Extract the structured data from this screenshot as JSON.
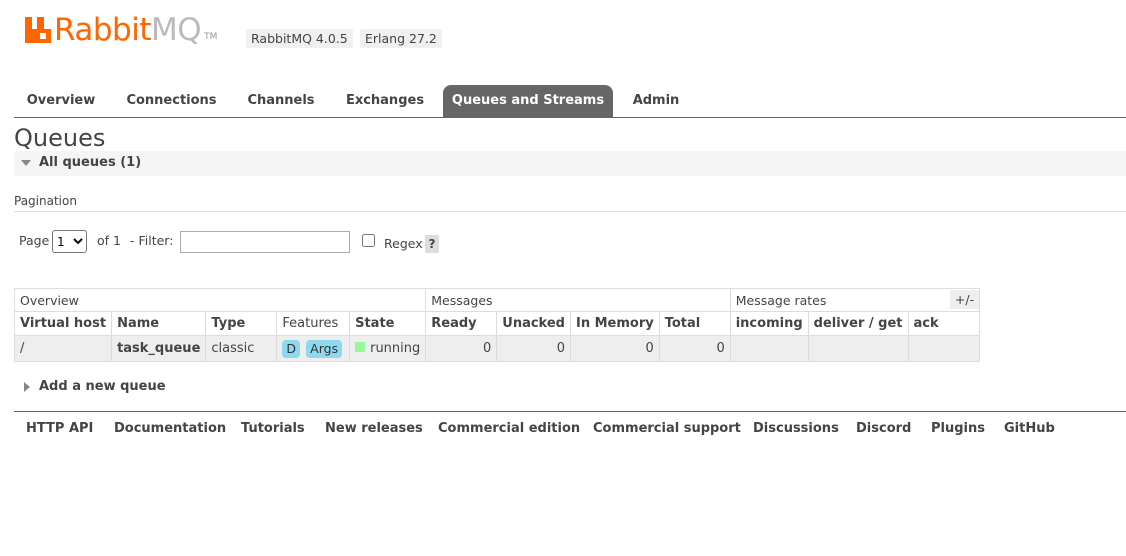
{
  "header": {
    "logo_rabbit": "Rabbit",
    "logo_mq": "MQ",
    "logo_tm": "TM",
    "rabbitmq_version": "RabbitMQ 4.0.5",
    "erlang_version": "Erlang 27.2"
  },
  "tabs": [
    {
      "label": "Overview"
    },
    {
      "label": "Connections"
    },
    {
      "label": "Channels"
    },
    {
      "label": "Exchanges"
    },
    {
      "label": "Queues and Streams",
      "active": true
    },
    {
      "label": "Admin"
    }
  ],
  "page": {
    "title": "Queues",
    "section_label": "All queues (1)"
  },
  "pagination": {
    "label": "Pagination",
    "page_text": "Page",
    "page_value": "1",
    "of_text": "of 1",
    "filter_text": "- Filter:",
    "filter_value": "",
    "regex_label": "Regex",
    "help": "?"
  },
  "table": {
    "groups": [
      "Overview",
      "Messages",
      "Message rates"
    ],
    "plus_minus": "+/-",
    "columns": {
      "virtual_host": "Virtual host",
      "name": "Name",
      "type": "Type",
      "features": "Features",
      "state": "State",
      "ready": "Ready",
      "unacked": "Unacked",
      "in_memory": "In Memory",
      "total": "Total",
      "incoming": "incoming",
      "deliver_get": "deliver / get",
      "ack": "ack"
    },
    "rows": [
      {
        "virtual_host": "/",
        "name": "task_queue",
        "type": "classic",
        "features": [
          "D",
          "Args"
        ],
        "state": "running",
        "ready": "0",
        "unacked": "0",
        "in_memory": "0",
        "total": "0",
        "incoming": "",
        "deliver_get": "",
        "ack": ""
      }
    ]
  },
  "add_queue_label": "Add a new queue",
  "footer": [
    "HTTP API",
    "Documentation",
    "Tutorials",
    "New releases",
    "Commercial edition",
    "Commercial support",
    "Discussions",
    "Discord",
    "Plugins",
    "GitHub"
  ],
  "colors": {
    "brand": "#ff6600",
    "active_tab": "#666666",
    "feature_pill": "#8ed8f0",
    "running": "#98f898"
  }
}
